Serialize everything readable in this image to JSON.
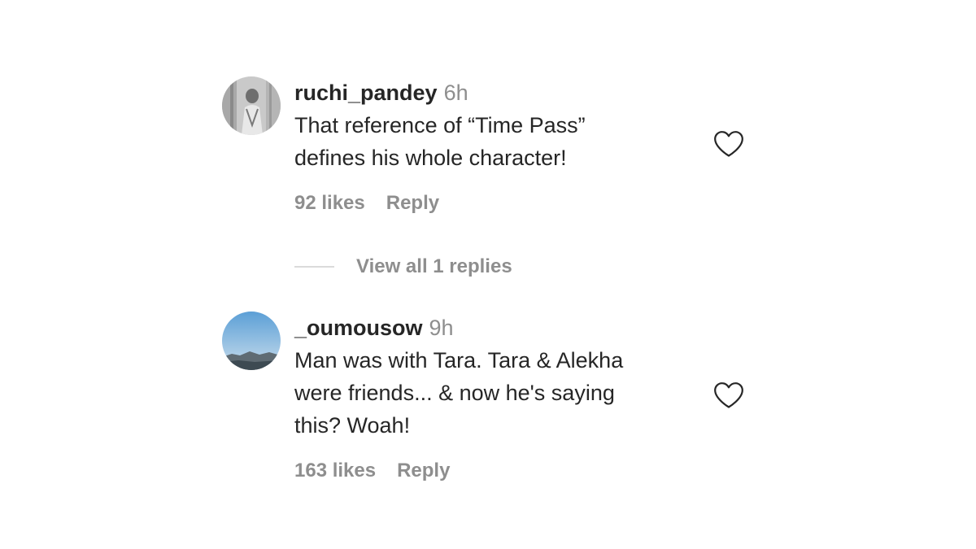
{
  "comments": [
    {
      "username": "ruchi_pandey",
      "time": "6h",
      "text_lines": [
        "That reference of “Time Pass”",
        "defines his whole character!"
      ],
      "likes": "92 likes",
      "reply_label": "Reply",
      "like_icon": "heart-outline-icon"
    },
    {
      "username": "_oumousow",
      "time": "9h",
      "text_lines": [
        "Man was with Tara. Tara & Alekha",
        "were friends... & now he's saying",
        "this? Woah!"
      ],
      "likes": "163 likes",
      "reply_label": "Reply",
      "like_icon": "heart-outline-icon"
    }
  ],
  "view_replies": {
    "label": "View all 1 replies"
  },
  "colors": {
    "primary_text": "#262626",
    "secondary_text": "#8e8e8e",
    "divider": "#dbdbdb"
  }
}
